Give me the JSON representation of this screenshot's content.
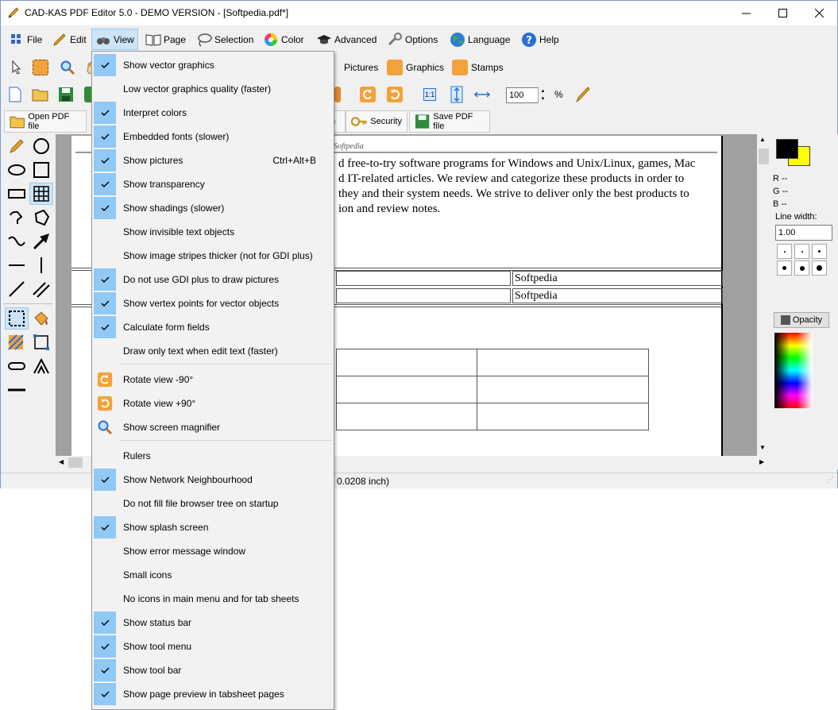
{
  "window": {
    "title": "CAD-KAS PDF Editor 5.0 - DEMO VERSION - [Softpedia.pdf*]"
  },
  "menubar": {
    "items": [
      "File",
      "Edit",
      "View",
      "Page",
      "Selection",
      "Color",
      "Advanced",
      "Options",
      "Language",
      "Help"
    ]
  },
  "toolbar": {
    "pictures": "Pictures",
    "graphics": "Graphics",
    "stamps": "Stamps",
    "zoom_value": "100",
    "zoom_unit": "%",
    "ratio": "1:1"
  },
  "tabs": {
    "open_pdf": "Open PDF file",
    "security": "Security",
    "save_pdf": "Save PDF file",
    "partial": "n"
  },
  "document": {
    "header": "Softpedia",
    "lines": [
      "d free-to-try software programs for Windows and Unix/Linux, games, Mac",
      "d IT-related articles. We review and categorize these products in order to",
      "they and their system needs. We strive to deliver only the best products to",
      "ion and review notes."
    ],
    "cell1": "Softpedia",
    "cell2": "Softpedia"
  },
  "status": {
    "text": "0.0208 inch)"
  },
  "right_panel": {
    "r": "R --",
    "g": "G --",
    "b": "B --",
    "line_width_label": "Line width:",
    "line_width_value": "1.00",
    "opacity": "Opacity"
  },
  "view_menu": {
    "items": [
      {
        "label": "Show vector graphics",
        "checked": true
      },
      {
        "label": "Low vector graphics quality (faster)",
        "checked": false
      },
      {
        "label": "Interpret colors",
        "checked": true
      },
      {
        "label": "Embedded fonts (slower)",
        "checked": true
      },
      {
        "label": "Show pictures",
        "checked": true,
        "shortcut": "Ctrl+Alt+B"
      },
      {
        "label": "Show transparency",
        "checked": true
      },
      {
        "label": "Show shadings (slower)",
        "checked": true
      },
      {
        "label": "Show invisible text objects",
        "checked": false
      },
      {
        "label": "Show image stripes thicker (not for GDI plus)",
        "checked": false
      },
      {
        "label": "Do not use GDI plus to draw pictures",
        "checked": true
      },
      {
        "label": "Show vertex points for vector objects",
        "checked": true
      },
      {
        "label": "Calculate form fields",
        "checked": true
      },
      {
        "label": "Draw only text when edit text  (faster)",
        "checked": false
      },
      {
        "label": "Rotate view -90°",
        "icon": "rotate-left-icon"
      },
      {
        "label": "Rotate view +90°",
        "icon": "rotate-right-icon"
      },
      {
        "label": "Show screen magnifier",
        "icon": "magnifier-icon"
      },
      {
        "label": "Rulers",
        "checked": false
      },
      {
        "label": "Show Network Neighbourhood",
        "checked": true
      },
      {
        "label": "Do not fill file browser tree on startup",
        "checked": false
      },
      {
        "label": "Show splash screen",
        "checked": true
      },
      {
        "label": "Show error message window",
        "checked": false
      },
      {
        "label": "Small icons",
        "checked": false
      },
      {
        "label": "No icons in main menu and for tab sheets",
        "checked": false
      },
      {
        "label": "Show status bar",
        "checked": true
      },
      {
        "label": "Show tool menu",
        "checked": true
      },
      {
        "label": "Show tool bar",
        "checked": true
      },
      {
        "label": "Show page preview in tabsheet pages",
        "checked": true
      }
    ]
  }
}
